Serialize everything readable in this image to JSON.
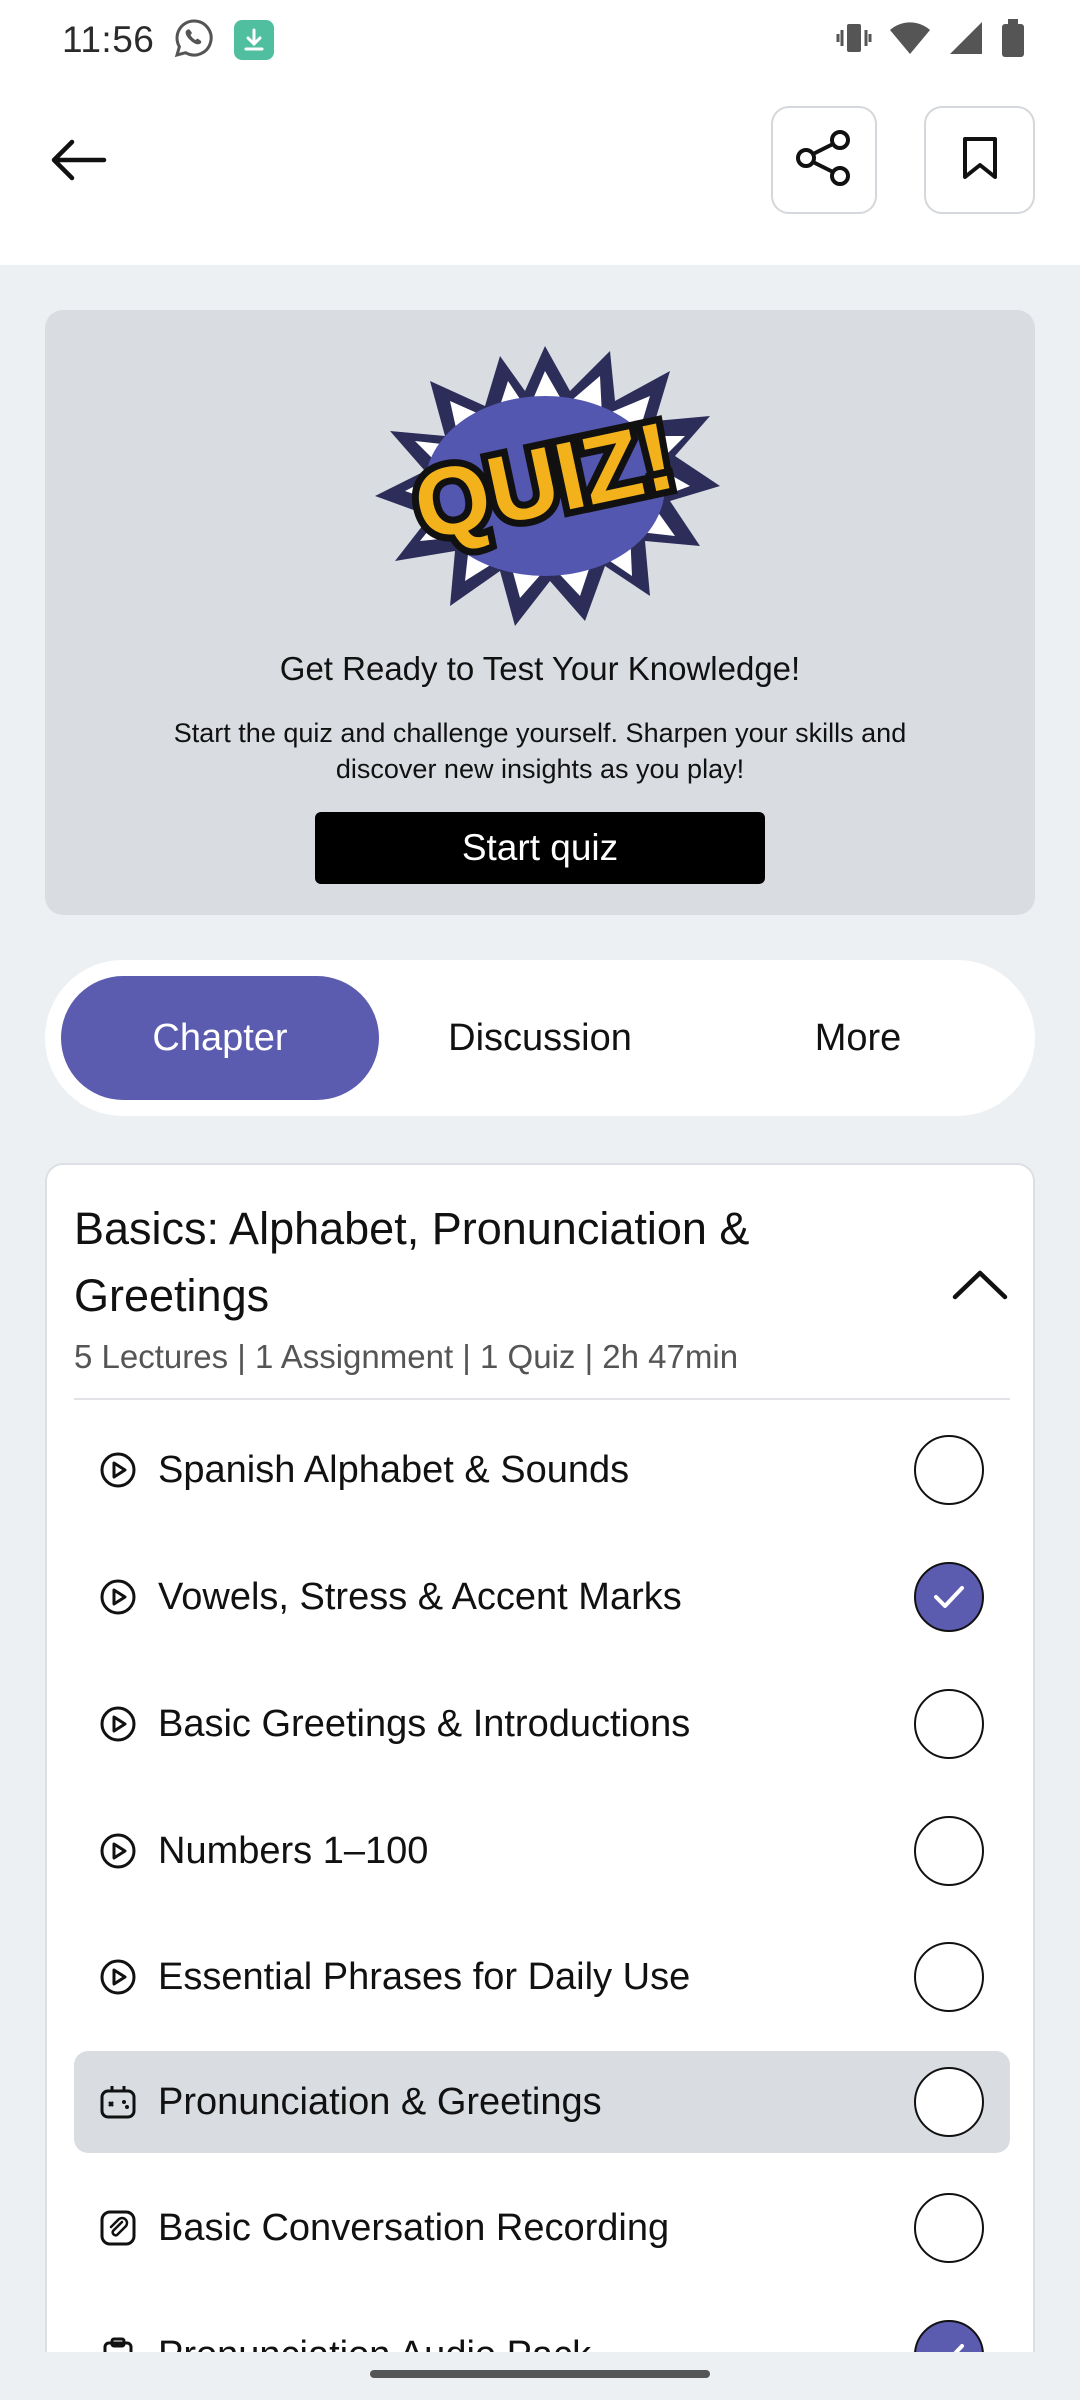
{
  "status_bar": {
    "time": "11:56",
    "icons": [
      "whatsapp-icon",
      "download-icon",
      "vibrate-icon",
      "wifi-icon",
      "signal-icon",
      "battery-icon"
    ]
  },
  "app_bar": {
    "icons": [
      "back-arrow-icon",
      "share-icon",
      "bookmark-icon"
    ]
  },
  "quiz": {
    "logo_text": "QUIZ!",
    "heading": "Get Ready to Test Your Knowledge!",
    "subtitle": "Start the quiz and challenge yourself. Sharpen your skills and discover new insights as you play!",
    "button": "Start quiz"
  },
  "tabs": [
    {
      "label": "Chapter",
      "active": true
    },
    {
      "label": "Discussion",
      "active": false
    },
    {
      "label": "More",
      "active": false
    }
  ],
  "chapter": {
    "title": "Basics: Alphabet, Pronunciation & Greetings",
    "meta": "5 Lectures | 1 Assignment | 1 Quiz | 2h 47min",
    "expanded": true,
    "items": [
      {
        "label": "Spanish Alphabet & Sounds",
        "icon": "play-circle-icon",
        "completed": false
      },
      {
        "label": "Vowels, Stress & Accent Marks",
        "icon": "play-circle-icon",
        "completed": true
      },
      {
        "label": "Basic Greetings & Introductions",
        "icon": "play-circle-icon",
        "completed": false
      },
      {
        "label": "Numbers 1–100",
        "icon": "play-circle-icon",
        "completed": false
      },
      {
        "label": "Essential Phrases for Daily Use",
        "icon": "play-circle-icon",
        "completed": false
      },
      {
        "label": "Pronunciation & Greetings",
        "icon": "quiz-icon",
        "completed": false,
        "highlighted": true
      },
      {
        "label": "Basic Conversation Recording",
        "icon": "assignment-icon",
        "completed": false
      },
      {
        "label": "Pronunciation Audio Pack",
        "icon": "resource-icon",
        "completed": true
      }
    ]
  },
  "colors": {
    "accent": "#5b5bb0",
    "card_bg": "#d9dde2",
    "page_bg": "#edf0f3"
  }
}
